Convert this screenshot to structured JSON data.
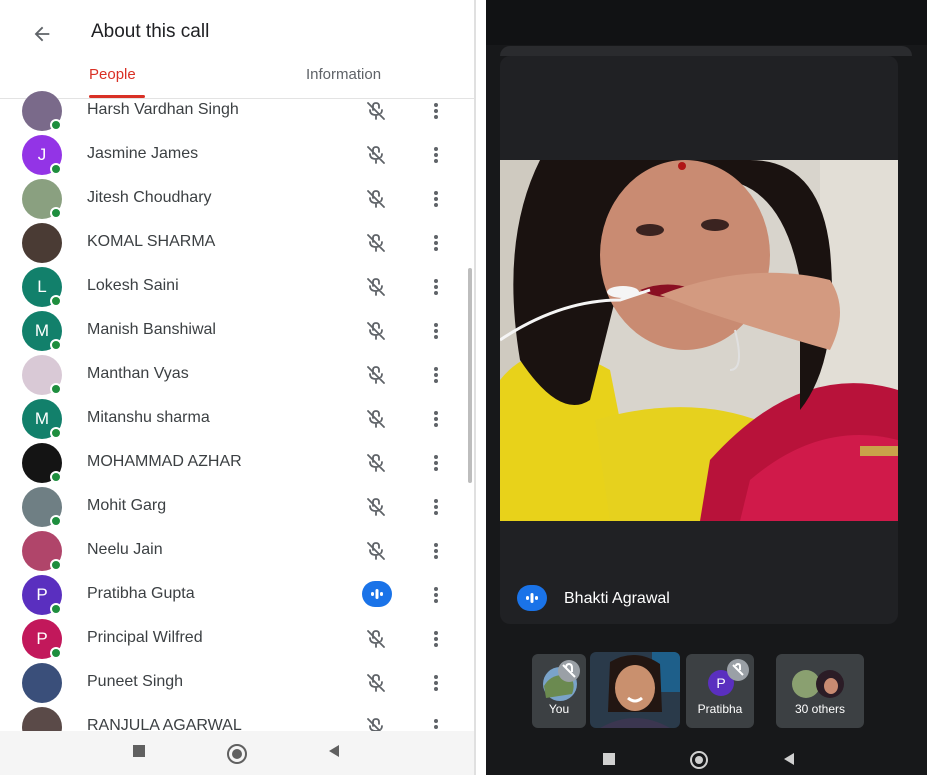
{
  "header": {
    "title": "About this call",
    "tabs": [
      {
        "label": "People",
        "active": true
      },
      {
        "label": "Information",
        "active": false
      }
    ]
  },
  "people": [
    {
      "name": "Harsh Vardhan Singh",
      "avatar_type": "photo",
      "avatar_color": "#7a6a8a",
      "online": true,
      "status": "muted"
    },
    {
      "name": "Jasmine James",
      "avatar_type": "letter",
      "initial": "J",
      "avatar_color": "#9334e6",
      "online": true,
      "status": "muted"
    },
    {
      "name": "Jitesh Choudhary",
      "avatar_type": "photo",
      "avatar_color": "#8aa080",
      "online": true,
      "status": "muted"
    },
    {
      "name": "KOMAL SHARMA",
      "avatar_type": "photo",
      "avatar_color": "#4a3b34",
      "online": false,
      "status": "muted"
    },
    {
      "name": "Lokesh Saini",
      "avatar_type": "letter",
      "initial": "L",
      "avatar_color": "#12806b",
      "online": true,
      "status": "muted"
    },
    {
      "name": "Manish Banshiwal",
      "avatar_type": "letter",
      "initial": "M",
      "avatar_color": "#12806b",
      "online": true,
      "status": "muted"
    },
    {
      "name": "Manthan Vyas",
      "avatar_type": "photo",
      "avatar_color": "#d9c9d6",
      "online": true,
      "status": "muted"
    },
    {
      "name": "Mitanshu sharma",
      "avatar_type": "letter",
      "initial": "M",
      "avatar_color": "#12806b",
      "online": true,
      "status": "muted"
    },
    {
      "name": "MOHAMMAD AZHAR",
      "avatar_type": "photo",
      "avatar_color": "#141414",
      "online": true,
      "status": "muted"
    },
    {
      "name": "Mohit Garg",
      "avatar_type": "photo",
      "avatar_color": "#6f7f84",
      "online": true,
      "status": "muted"
    },
    {
      "name": "Neelu Jain",
      "avatar_type": "photo",
      "avatar_color": "#b0456a",
      "online": true,
      "status": "muted"
    },
    {
      "name": "Pratibha Gupta",
      "avatar_type": "letter",
      "initial": "P",
      "avatar_color": "#5a2fbf",
      "online": true,
      "status": "speaking"
    },
    {
      "name": "Principal Wilfred",
      "avatar_type": "letter",
      "initial": "P",
      "avatar_color": "#c2185b",
      "online": true,
      "status": "muted"
    },
    {
      "name": "Puneet Singh",
      "avatar_type": "photo",
      "avatar_color": "#3a4f7a",
      "online": false,
      "status": "muted"
    },
    {
      "name": "RANJULA AGARWAL",
      "avatar_type": "photo",
      "avatar_color": "#5a4a48",
      "online": false,
      "status": "muted"
    }
  ],
  "main_video": {
    "name": "Bhakti Agrawal",
    "speaking": true
  },
  "tiles": [
    {
      "label": "You",
      "type": "photo",
      "muted": true
    },
    {
      "label": "",
      "type": "video",
      "muted": false
    },
    {
      "label": "Pratibha",
      "type": "letter",
      "initial": "P",
      "avatar_color": "#5a2fbf",
      "muted": true
    },
    {
      "label": "30 others",
      "type": "group",
      "muted": false
    }
  ],
  "icons": {
    "back": "arrow-left-icon",
    "mic_off": "mic-off-icon",
    "more": "more-vert-icon",
    "speaking": "speaking-indicator-icon",
    "nav_recents": "square-icon",
    "nav_home": "circle-icon",
    "nav_back": "triangle-back-icon"
  },
  "colors": {
    "accent": "#d93025",
    "speaking": "#1a73e8",
    "online": "#1e8e3e"
  }
}
